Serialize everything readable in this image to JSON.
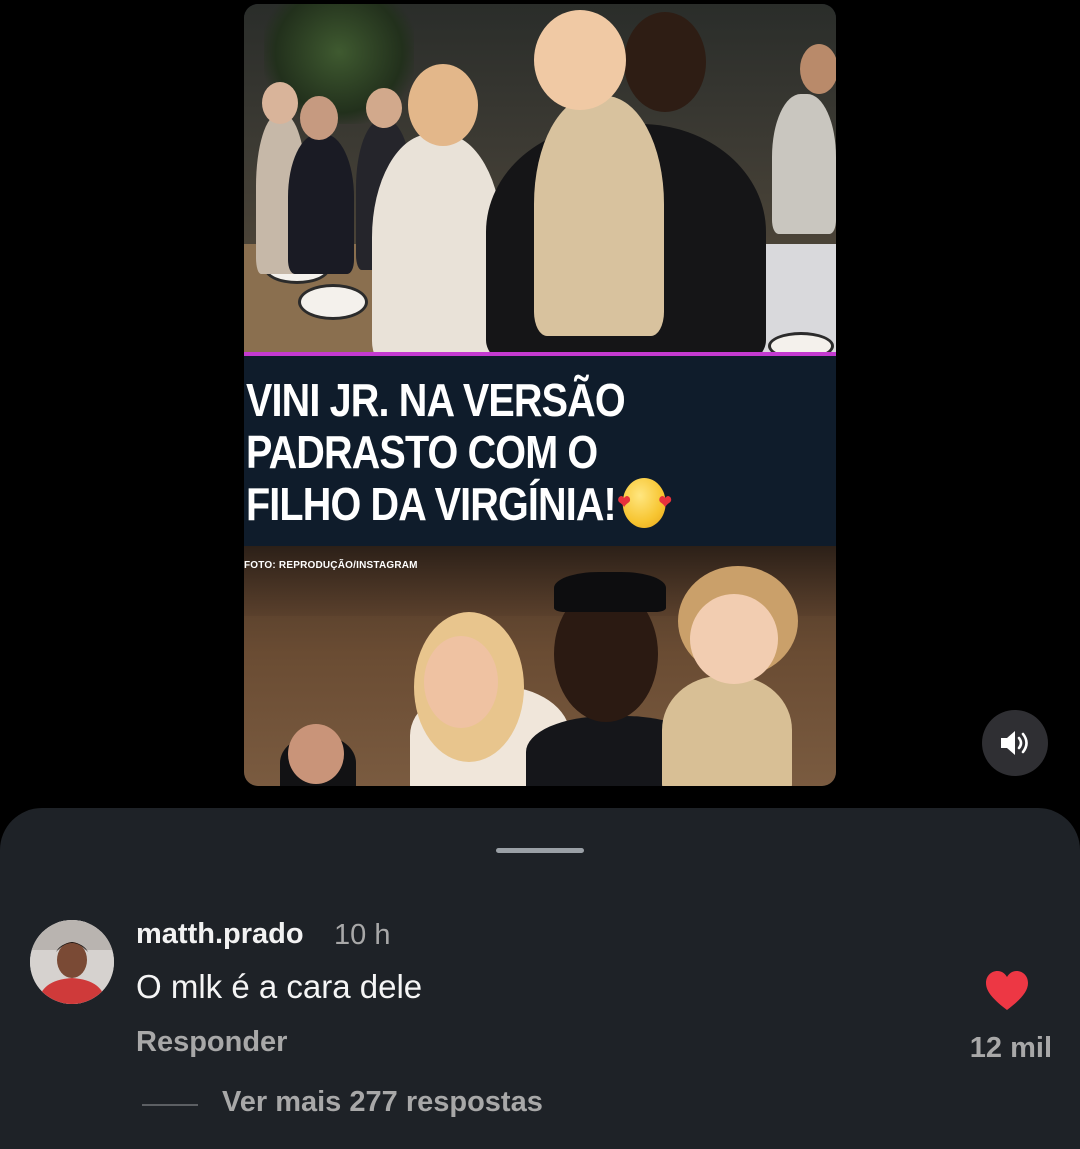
{
  "post": {
    "headline_lines": [
      "VINI JR. NA VERSÃO",
      "PADRASTO COM O",
      "FILHO DA VIRGÍNIA!"
    ],
    "headline_emoji": "smiling-face-with-hearts",
    "photo_credit": "FOTO: REPRODUÇÃO/INSTAGRAM",
    "accent_color": "#c43ad1"
  },
  "controls": {
    "sound_icon": "speaker-volume-icon"
  },
  "comment": {
    "username": "matth.prado",
    "time": "10 h",
    "text": "O mlk é a cara dele",
    "reply_label": "Responder",
    "like_count": "12 mil",
    "like_color": "#ed3744",
    "more_replies_label": "Ver mais 277 respostas"
  }
}
